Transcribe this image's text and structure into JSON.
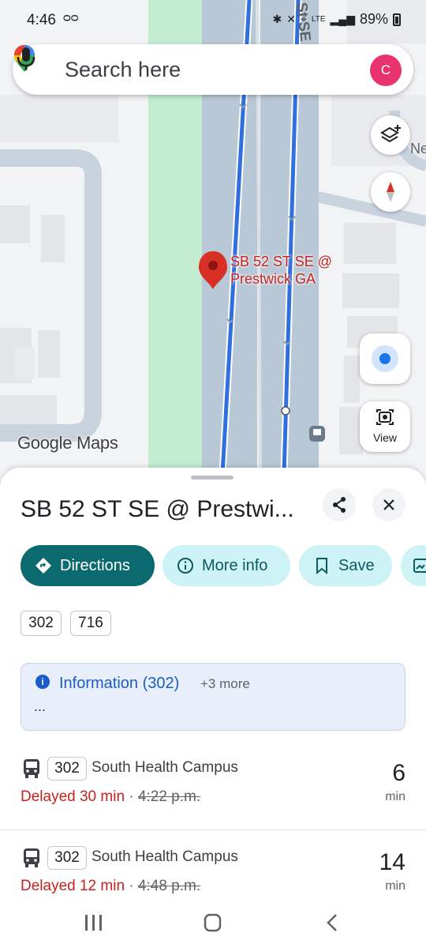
{
  "status_bar": {
    "time": "4:46",
    "battery": "89%"
  },
  "search": {
    "placeholder": "Search here",
    "avatar_letter": "C"
  },
  "map": {
    "stop_label_line1": "SB 52 ST SE @",
    "stop_label_line2": "Prestwick GA",
    "road_label_top": "St SE",
    "road_label_right": "Ne",
    "logo_text": "Google Maps",
    "view_label": "View",
    "colors": {
      "park": "#c3ecd1",
      "road": "#b9c8d6",
      "transit_line": "#2f6fe0",
      "pin": "#d93025"
    }
  },
  "place": {
    "title": "SB 52 ST SE @ Prestwi..."
  },
  "actions": {
    "directions": "Directions",
    "more_info": "More info",
    "save": "Save"
  },
  "routes": [
    "302",
    "716"
  ],
  "info": {
    "title": "Information (302)",
    "more": "+3 more",
    "ellipsis": "..."
  },
  "departures": [
    {
      "route": "302",
      "destination": "South Health Campus",
      "status": "Delayed 30 min",
      "separator": "·",
      "scheduled": "4:22 p.m.",
      "minutes": "6",
      "unit": "min"
    },
    {
      "route": "302",
      "destination": "South Health Campus",
      "status": "Delayed 12 min",
      "separator": "·",
      "scheduled": "4:48 p.m.",
      "minutes": "14",
      "unit": "min"
    }
  ]
}
